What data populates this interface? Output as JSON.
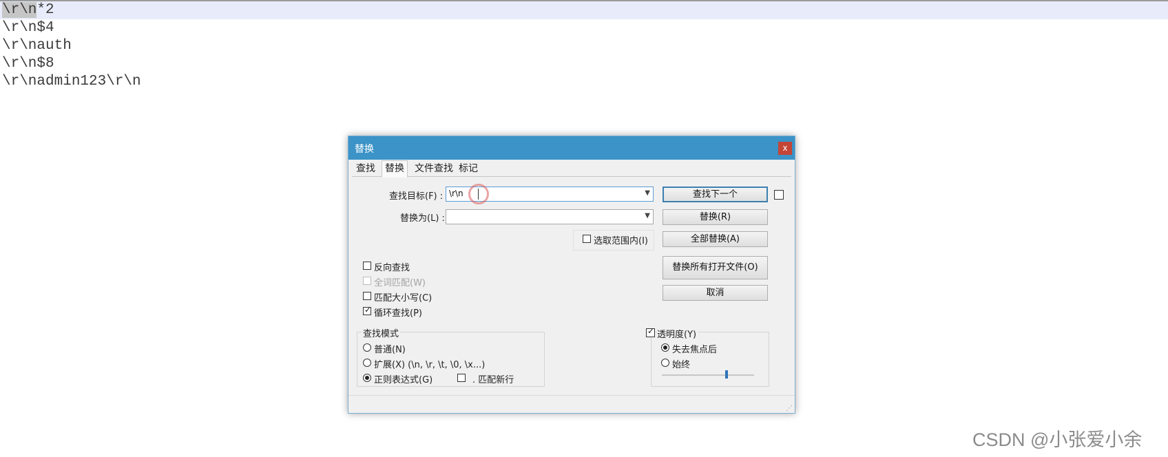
{
  "editor": {
    "lines": [
      {
        "selected": "\\r\\n",
        "rest": "*2"
      },
      {
        "text": "\\r\\n$4"
      },
      {
        "text": "\\r\\nauth"
      },
      {
        "text": "\\r\\n$8"
      },
      {
        "text": "\\r\\nadmin123\\r\\n"
      }
    ]
  },
  "dialog": {
    "title": "替换",
    "close_label": "x",
    "tabs": [
      {
        "label": "查找",
        "active": false
      },
      {
        "label": "替换",
        "active": true
      },
      {
        "label": "文件查找",
        "active": false
      },
      {
        "label": "标记",
        "active": false
      }
    ],
    "find_label": "查找目标(F) :",
    "find_value": "\\r\\n",
    "replace_label": "替换为(L) :",
    "replace_value": "",
    "in_selection_label": "选取范围内(I)",
    "buttons": {
      "find_next": "查找下一个",
      "replace": "替换(R)",
      "replace_all": "全部替换(A)",
      "replace_all_open": "替换所有打开文件(O)",
      "cancel": "取消"
    },
    "options": {
      "backward": {
        "label": "反向查找",
        "checked": false
      },
      "whole_word": {
        "label": "全词匹配(W)",
        "checked": false,
        "disabled": true
      },
      "match_case": {
        "label": "匹配大小写(C)",
        "checked": false
      },
      "wrap": {
        "label": "循环查找(P)",
        "checked": true
      }
    },
    "search_mode": {
      "title": "查找模式",
      "normal": "普通(N)",
      "extended": "扩展(X) (\\n, \\r, \\t, \\0, \\x...)",
      "regex": "正则表达式(G)",
      "selected": "regex",
      "dot_newline": ". 匹配新行"
    },
    "transparency": {
      "label": "透明度(Y)",
      "checked": true,
      "on_lose_focus": "失去焦点后",
      "always": "始终",
      "selected": "on_lose_focus",
      "level": 0.7
    }
  },
  "watermark": "CSDN @小张爱小余"
}
